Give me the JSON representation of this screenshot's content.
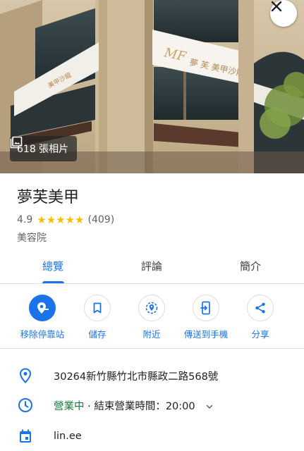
{
  "hero": {
    "photo_count_label": "618 張相片",
    "sign_text": "MF 夢 芙 美甲沙龍"
  },
  "place": {
    "name": "夢芙美甲",
    "rating": "4.9",
    "rating_value": 4.9,
    "stars": "★★★★★",
    "review_count": "(409)",
    "category": "美容院"
  },
  "tabs": [
    {
      "label": "總覽",
      "active": true
    },
    {
      "label": "評論",
      "active": false
    },
    {
      "label": "簡介",
      "active": false
    }
  ],
  "actions": [
    {
      "label": "移除停靠站",
      "icon": "remove-stop-icon"
    },
    {
      "label": "儲存",
      "icon": "bookmark-icon"
    },
    {
      "label": "附近",
      "icon": "nearby-icon"
    },
    {
      "label": "傳送到手機",
      "icon": "send-to-phone-icon"
    },
    {
      "label": "分享",
      "icon": "share-icon"
    }
  ],
  "details": {
    "address": "30264新竹縣竹北市縣政二路568號",
    "hours_status": "營業中",
    "hours_detail": " · 結束營業時間：20:00",
    "website": "lin.ee"
  },
  "colors": {
    "accent": "#1a73e8",
    "open": "#188038",
    "star": "#fbbc04"
  }
}
